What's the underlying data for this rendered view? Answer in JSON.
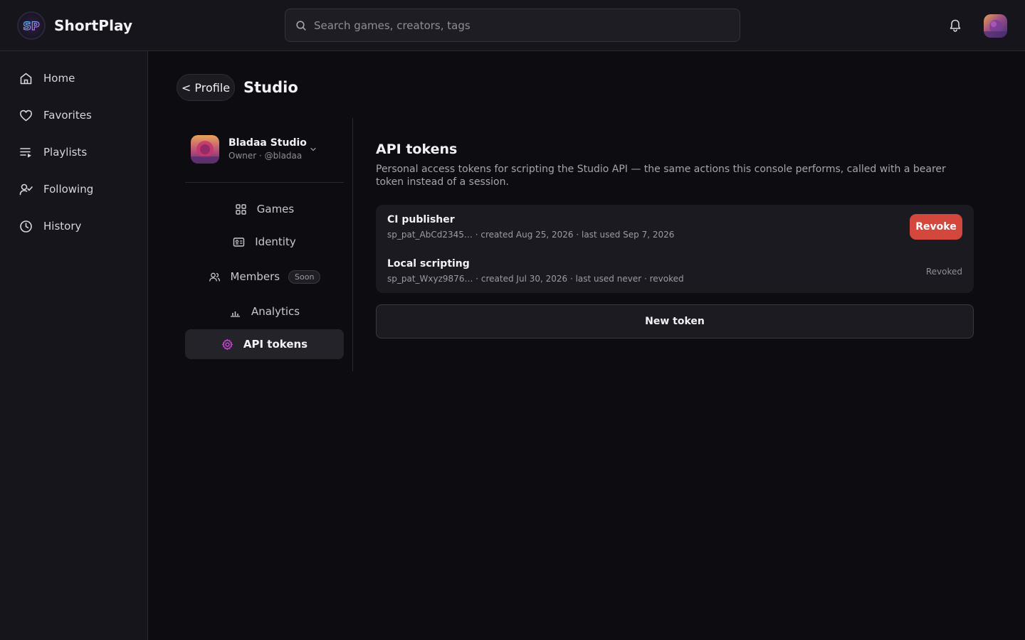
{
  "app": {
    "name": "ShortPlay"
  },
  "search": {
    "placeholder": "Search games, creators, tags"
  },
  "sidebar": {
    "items": [
      {
        "label": "Home",
        "icon": "home-icon"
      },
      {
        "label": "Favorites",
        "icon": "heart-icon"
      },
      {
        "label": "Playlists",
        "icon": "playlist-icon"
      },
      {
        "label": "Following",
        "icon": "user-check-icon"
      },
      {
        "label": "History",
        "icon": "clock-icon"
      }
    ]
  },
  "header": {
    "back_label": "< Profile",
    "title": "Studio"
  },
  "studio": {
    "name": "Bladaa Studio",
    "subtitle": "Owner · @bladaa"
  },
  "subnav": {
    "items": [
      {
        "label": "Games",
        "icon": "grid-icon"
      },
      {
        "label": "Identity",
        "icon": "id-card-icon"
      },
      {
        "label": "Members",
        "icon": "users-icon",
        "badge": "Soon"
      },
      {
        "label": "Analytics",
        "icon": "bar-chart-icon"
      },
      {
        "label": "API tokens",
        "icon": "gear-icon",
        "active": true
      }
    ]
  },
  "content": {
    "title": "API tokens",
    "description": "Personal access tokens for scripting the Studio API — the same actions this console performs, called with a bearer token instead of a session.",
    "tokens": [
      {
        "name": "CI publisher",
        "meta": "sp_pat_AbCd2345… · created Aug 25, 2026 · last used Sep 7, 2026",
        "action": "Revoke"
      },
      {
        "name": "Local scripting",
        "meta": "sp_pat_Wxyz9876… · created Jul 30, 2026 · last used never · revoked",
        "status": "Revoked"
      }
    ],
    "new_token_label": "New token"
  },
  "colors": {
    "accent": "#c040d0",
    "danger": "#d3473d",
    "background": "#0d0c11",
    "panel": "#16151b"
  }
}
